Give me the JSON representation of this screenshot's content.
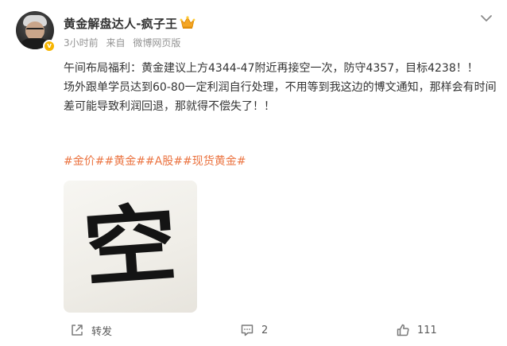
{
  "post": {
    "author": {
      "name": "黄金解盘达人-疯子王",
      "verified_badge": "v",
      "badge_color": "#f7b500"
    },
    "meta": {
      "time": "3小时前",
      "source_prefix": "来自",
      "source": "微博网页版"
    },
    "content": {
      "line1": "午间布局福利：黄金建议上方4344-47附近再接空一次，防守4357，目标4238！！",
      "line2": "场外跟单学员达到60-80一定利润自行处理，不用等到我这边的博文通知，那样会有时间差可能导致利润回退，那就得不偿失了！！"
    },
    "tags": "#金价##黄金##A股##现货黄金#",
    "tag_color": "#eb7340",
    "image": {
      "calligraphy": "空"
    },
    "actions": {
      "repost_label": "转发",
      "comment_count": "2",
      "like_count": "111"
    }
  }
}
